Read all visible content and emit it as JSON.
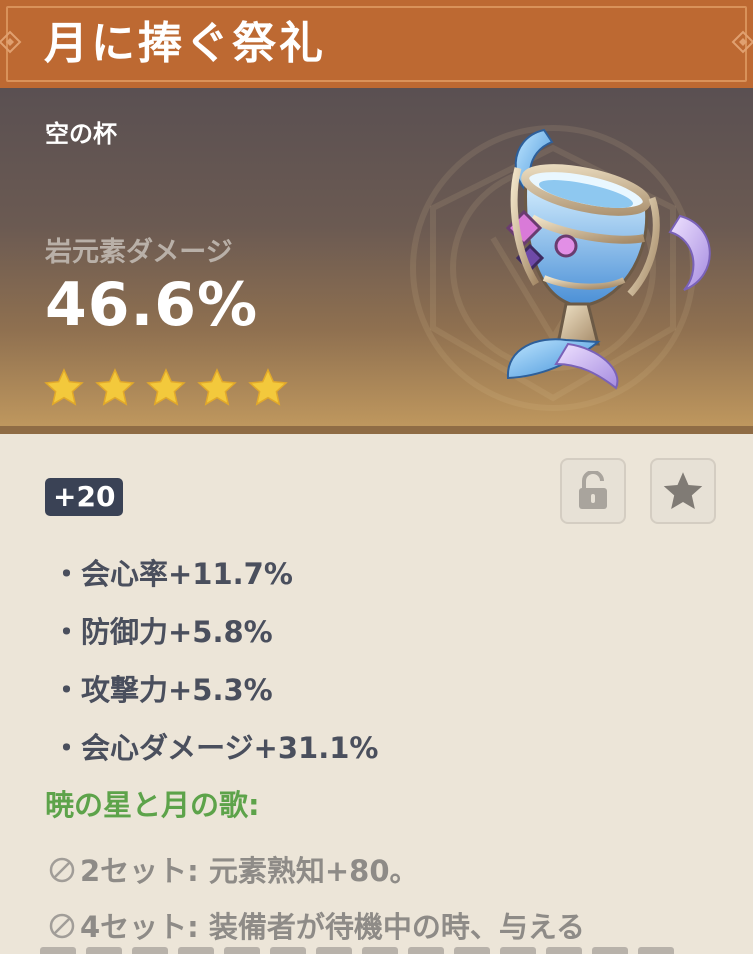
{
  "title": "月に捧ぐ祭礼",
  "artifact_type": "空の杯",
  "main_stat": {
    "name": "岩元素ダメージ",
    "value": "46.6%"
  },
  "rarity_stars": 5,
  "level": "+20",
  "icons": {
    "lock": "lock-open-icon",
    "favorite": "star-icon",
    "set_bonus": "circle-slash-icon",
    "rarity": "star-icon"
  },
  "substats": [
    "・会心率+11.7%",
    "・防御力+5.8%",
    "・攻撃力+5.3%",
    "・会心ダメージ+31.1%"
  ],
  "set": {
    "name": "暁の星と月の歌:",
    "bonus_2": "2セット: 元素熟知+80。",
    "bonus_4": "4セット: 装備者が待機中の時、与える"
  },
  "colors": {
    "title_bar": "#bd6932",
    "set_name": "#5da34a",
    "star": "#f3c93c",
    "level_badge": "#3a4255"
  }
}
